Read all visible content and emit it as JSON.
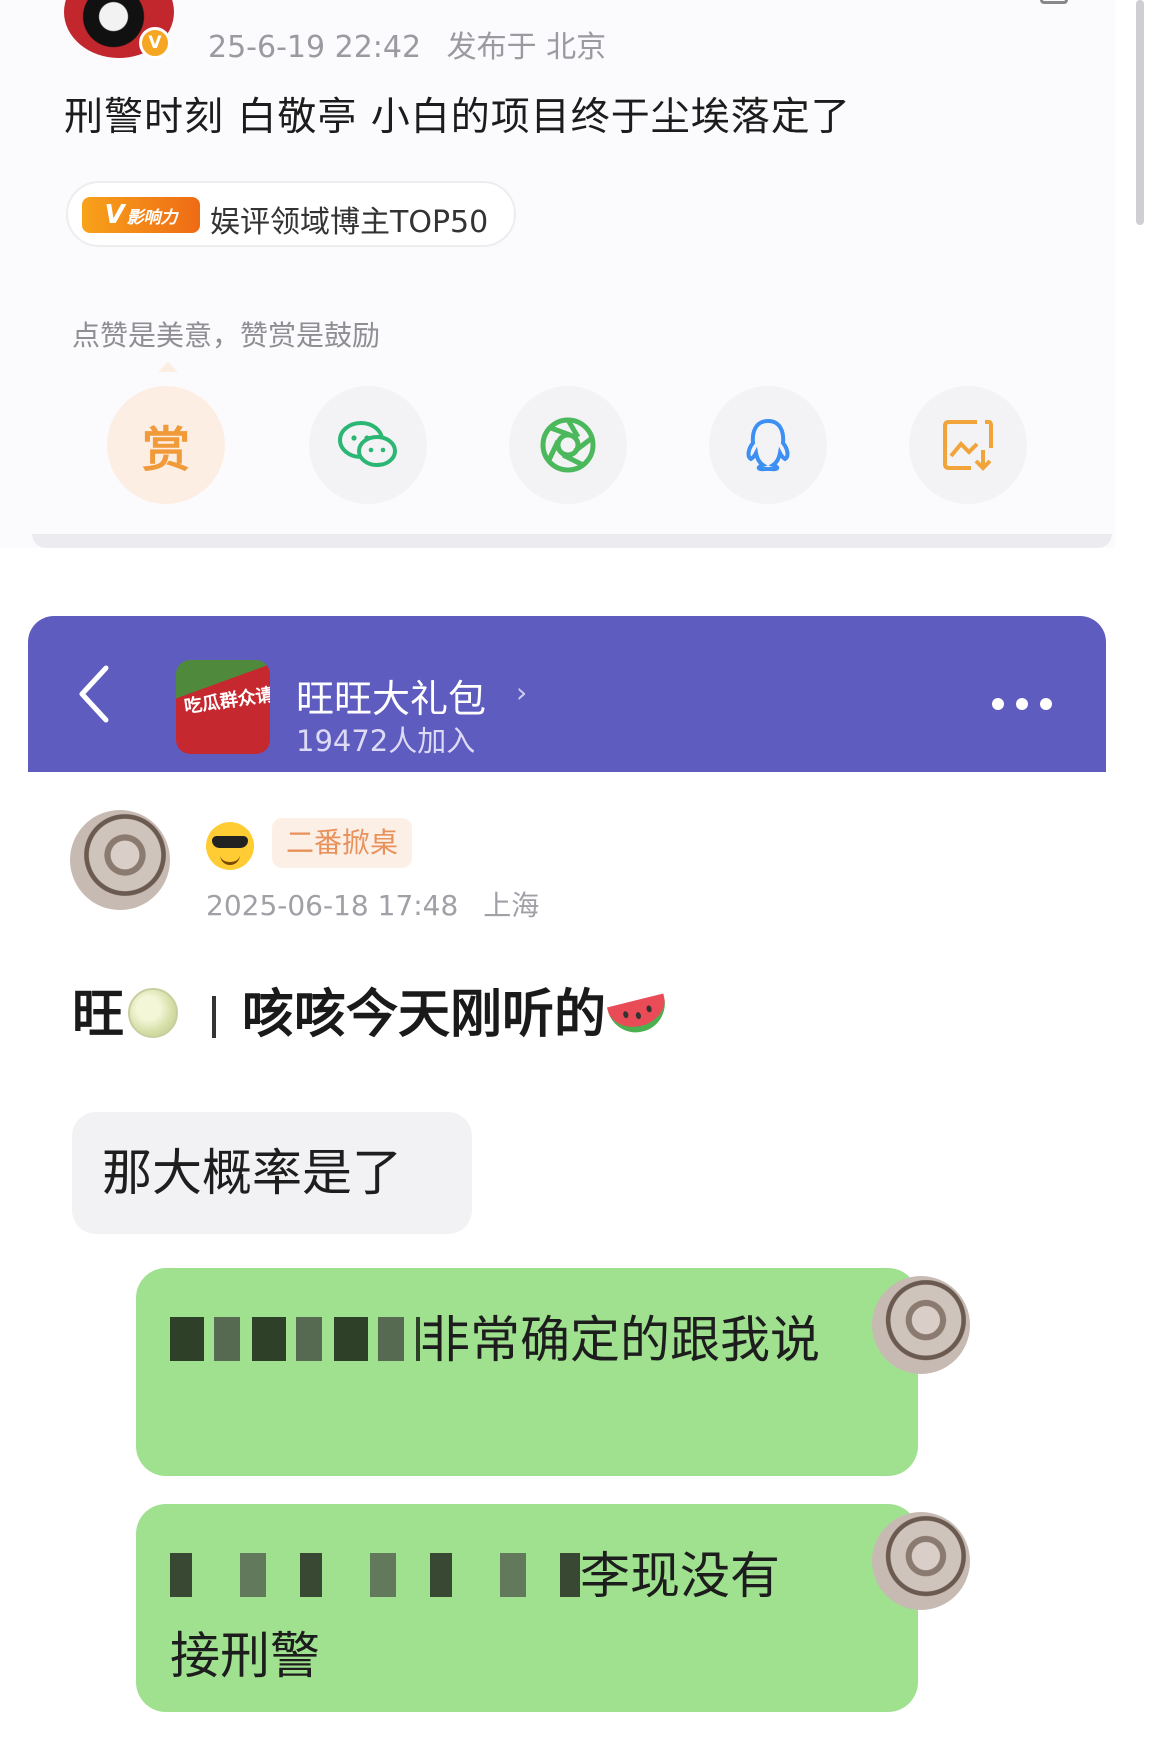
{
  "post": {
    "timestamp": "25-6-19 22:42",
    "location": "发布于 北京",
    "text": "刑警时刻  白敬亭  小白的项目终于尘埃落定了",
    "influence_badge": "影响力",
    "influence_label": "娱评领域博主TOP50",
    "tip": "点赞是美意，赞赏是鼓励",
    "reward_label": "赏",
    "share_icons": [
      "reward-icon",
      "wechat-icon",
      "moments-icon",
      "qq-icon",
      "save-image-icon"
    ]
  },
  "chat": {
    "group_name": "旺旺大礼包",
    "member_count": "19472人加入",
    "group_avatar_text": "吃瓜群众请就位",
    "sender_title": "二番掀桌",
    "message_time": "2025-06-18 17:48",
    "message_location": "上海",
    "message_title_a": "旺",
    "message_title_b": "咳咳今天刚听的",
    "bubble_left": "那大概率是了",
    "bubble_right_1": "非常确定的跟我说",
    "bubble_right_2a": "李现没有",
    "bubble_right_2b": "接刑警"
  },
  "colors": {
    "header_purple": "#5f5cbf",
    "bubble_green": "#9fe18f",
    "reward_orange": "#f09a3a",
    "wechat_green": "#2bb673",
    "qq_blue": "#3d8ff2"
  }
}
